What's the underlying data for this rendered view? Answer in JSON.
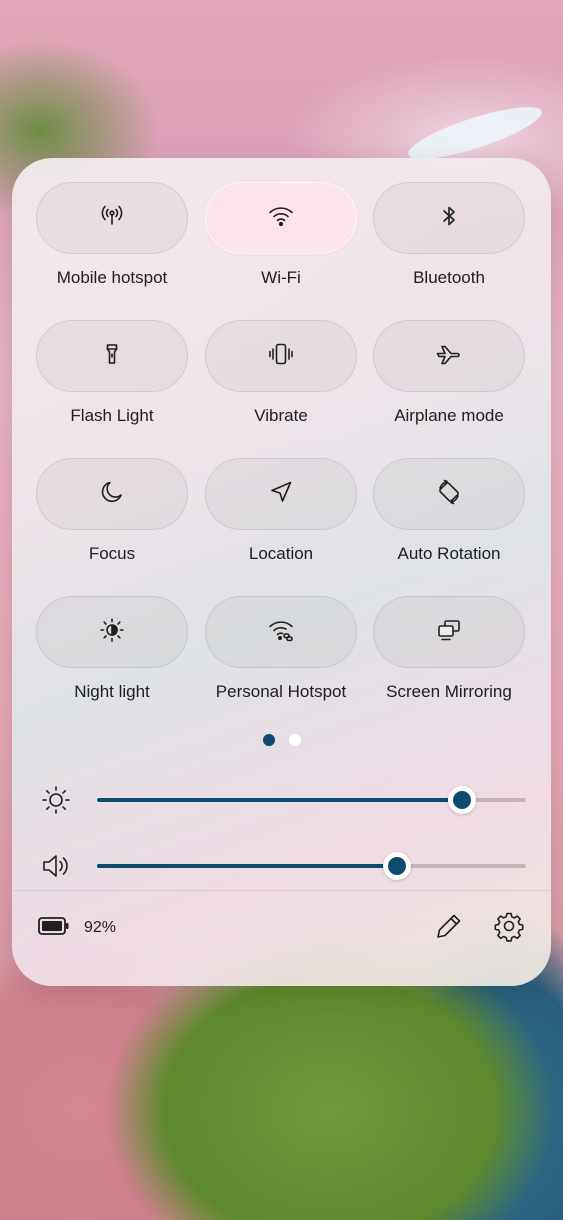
{
  "tiles": [
    {
      "label": "Mobile hotspot",
      "icon": "hotspot-antenna-icon",
      "active": false
    },
    {
      "label": "Wi-Fi",
      "icon": "wifi-icon",
      "active": true
    },
    {
      "label": "Bluetooth",
      "icon": "bluetooth-icon",
      "active": false
    },
    {
      "label": "Flash Light",
      "icon": "flashlight-icon",
      "active": false
    },
    {
      "label": "Vibrate",
      "icon": "vibrate-icon",
      "active": false
    },
    {
      "label": "Airplane mode",
      "icon": "airplane-icon",
      "active": false
    },
    {
      "label": "Focus",
      "icon": "moon-icon",
      "active": false
    },
    {
      "label": "Location",
      "icon": "location-arrow-icon",
      "active": false
    },
    {
      "label": "Auto Rotation",
      "icon": "rotation-icon",
      "active": false
    },
    {
      "label": "Night light",
      "icon": "night-light-icon",
      "active": false
    },
    {
      "label": "Personal Hotspot",
      "icon": "personal-hotspot-icon",
      "active": false
    },
    {
      "label": "Screen Mirroring",
      "icon": "screen-mirroring-icon",
      "active": false
    }
  ],
  "pager": {
    "pages": 2,
    "current": 1
  },
  "sliders": {
    "brightness": {
      "icon": "brightness-icon",
      "level": 0.85
    },
    "volume": {
      "icon": "volume-icon",
      "level": 0.7
    }
  },
  "footer": {
    "battery_icon": "battery-icon",
    "battery_percent": "92%",
    "edit_icon": "pencil-icon",
    "settings_icon": "gear-icon"
  },
  "colors": {
    "accent": "#0e4a6a",
    "active_tile": "#fce3ee"
  }
}
